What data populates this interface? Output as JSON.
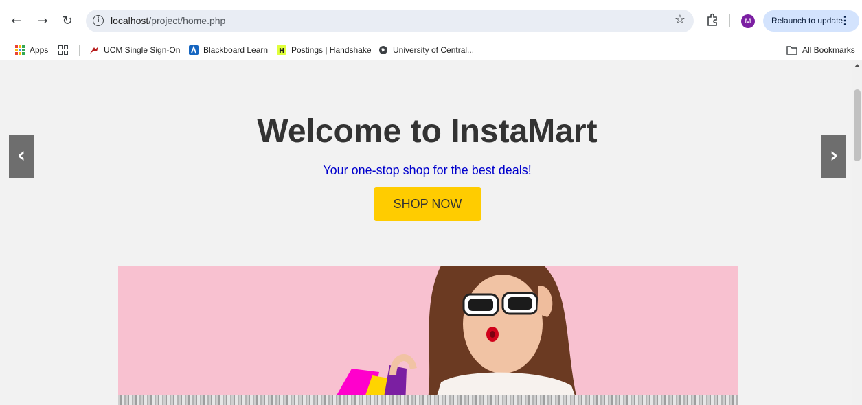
{
  "browser": {
    "url_host": "localhost",
    "url_path": "/project/home.php",
    "profile_initial": "M",
    "relaunch_label": "Relaunch to update",
    "bookmarks": [
      {
        "label": "Apps"
      },
      {
        "label": "UCM Single Sign-On"
      },
      {
        "label": "Blackboard Learn"
      },
      {
        "label": "Postings | Handshake"
      },
      {
        "label": "University of Central..."
      }
    ],
    "all_bookmarks_label": "All Bookmarks"
  },
  "hero": {
    "title": "Welcome to InstaMart",
    "subtitle": "Your one-stop shop for the best deals!",
    "cta_label": "SHOP NOW",
    "prev_arrow": "‹",
    "next_arrow": "›"
  },
  "colors": {
    "title": "#333333",
    "subtitle": "#0000cc",
    "cta_bg": "#ffcc00",
    "banner_bg": "#f8c1d0",
    "page_bg": "#f2f2f2"
  }
}
